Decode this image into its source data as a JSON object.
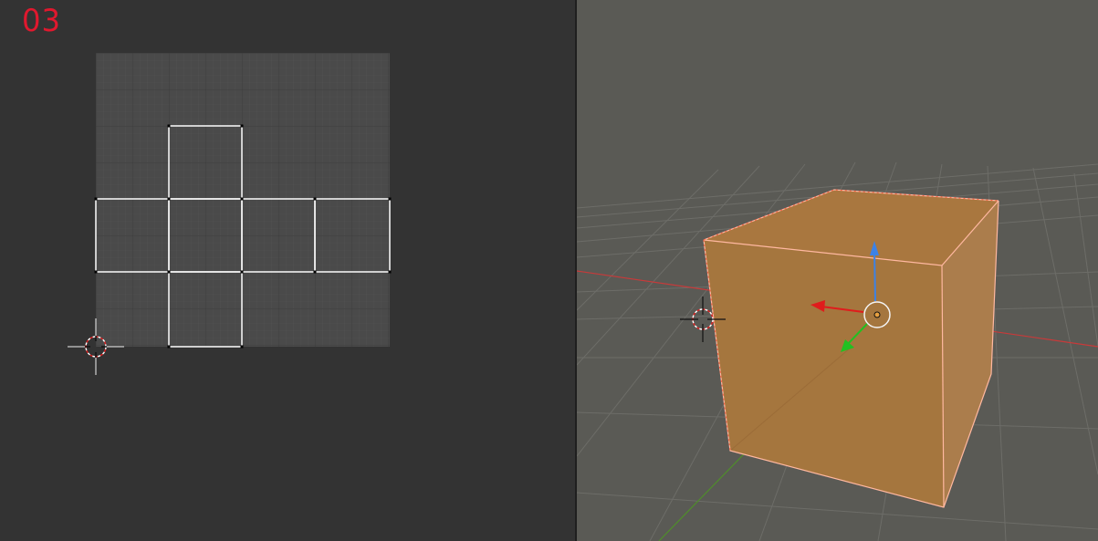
{
  "annotation": {
    "step_label": "03",
    "color": "#e0182e"
  },
  "uv_editor": {
    "background": "#333333",
    "image_bg": "#4a4a4a",
    "grid_minor": "#525252",
    "grid_major": "#3c3c3c",
    "edge_color": "#f2f2f2",
    "cursor_icon": "2d-cursor-crosshair-icon"
  },
  "viewport_3d": {
    "background": "#5a5a55",
    "floor_grid": "#6e6e69",
    "x_axis_color": "#c83a3a",
    "y_axis_color": "#4f8e2a",
    "cube_front": "#a5763e",
    "cube_top": "#a9773f",
    "cube_right": "#ab7c4a",
    "cube_outline": "#ff8a5c",
    "gizmo_x": "#e01c1c",
    "gizmo_y": "#22c022",
    "gizmo_z": "#3c82e6",
    "cursor_icon": "3d-cursor-crosshair-icon"
  }
}
